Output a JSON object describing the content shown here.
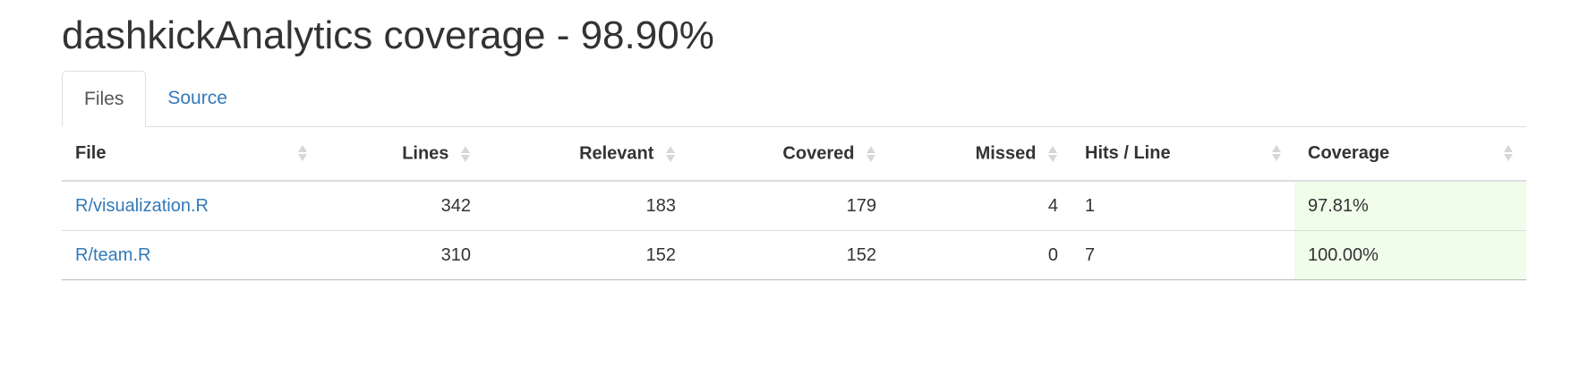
{
  "page": {
    "title": "dashkickAnalytics coverage - 98.90%"
  },
  "tabs": [
    {
      "label": "Files"
    },
    {
      "label": "Source"
    }
  ],
  "table": {
    "headers": [
      "File",
      "Lines",
      "Relevant",
      "Covered",
      "Missed",
      "Hits / Line",
      "Coverage"
    ],
    "rows": [
      {
        "file": "R/visualization.R",
        "lines": "342",
        "relevant": "183",
        "covered": "179",
        "missed": "4",
        "hits_per_line": "1",
        "coverage": "97.81%"
      },
      {
        "file": "R/team.R",
        "lines": "310",
        "relevant": "152",
        "covered": "152",
        "missed": "0",
        "hits_per_line": "7",
        "coverage": "100.00%"
      }
    ]
  },
  "colors": {
    "link": "#337ab7",
    "coverage_good_bg": "#f0fdea",
    "text": "#333333",
    "border": "#dddddd"
  },
  "icons": [
    "sort-icon"
  ]
}
